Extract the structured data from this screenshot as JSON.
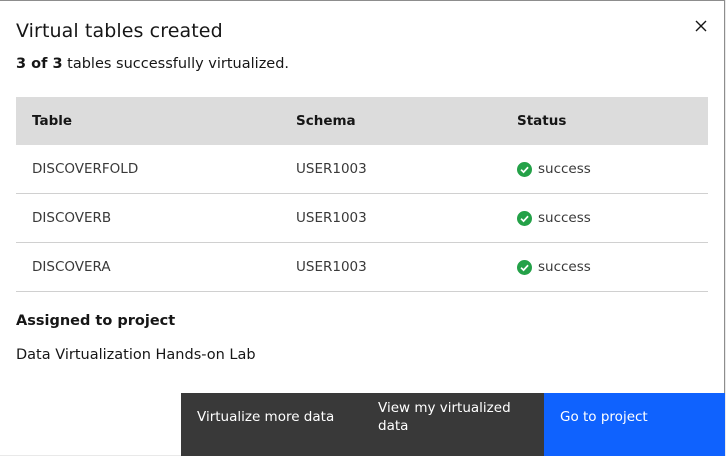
{
  "modal": {
    "title": "Virtual tables created",
    "summary_count": "3 of 3",
    "summary_text": " tables successfully virtualized."
  },
  "table": {
    "headers": [
      "Table",
      "Schema",
      "Status"
    ],
    "rows": [
      {
        "table": "DISCOVERFOLD",
        "schema": "USER1003",
        "status": "success"
      },
      {
        "table": "DISCOVERB",
        "schema": "USER1003",
        "status": "success"
      },
      {
        "table": "DISCOVERA",
        "schema": "USER1003",
        "status": "success"
      }
    ]
  },
  "assignment": {
    "label": "Assigned to project",
    "project": "Data Virtualization Hands-on Lab"
  },
  "buttons": {
    "virtualize_more": "Virtualize more data",
    "view_virtualized": "View my virtualized data",
    "go_to_project": "Go to project"
  },
  "icons": {
    "close": "close-icon",
    "success": "checkmark-filled-icon"
  },
  "colors": {
    "success": "#24a148",
    "primary": "#0f62fe",
    "secondary": "#393939"
  }
}
